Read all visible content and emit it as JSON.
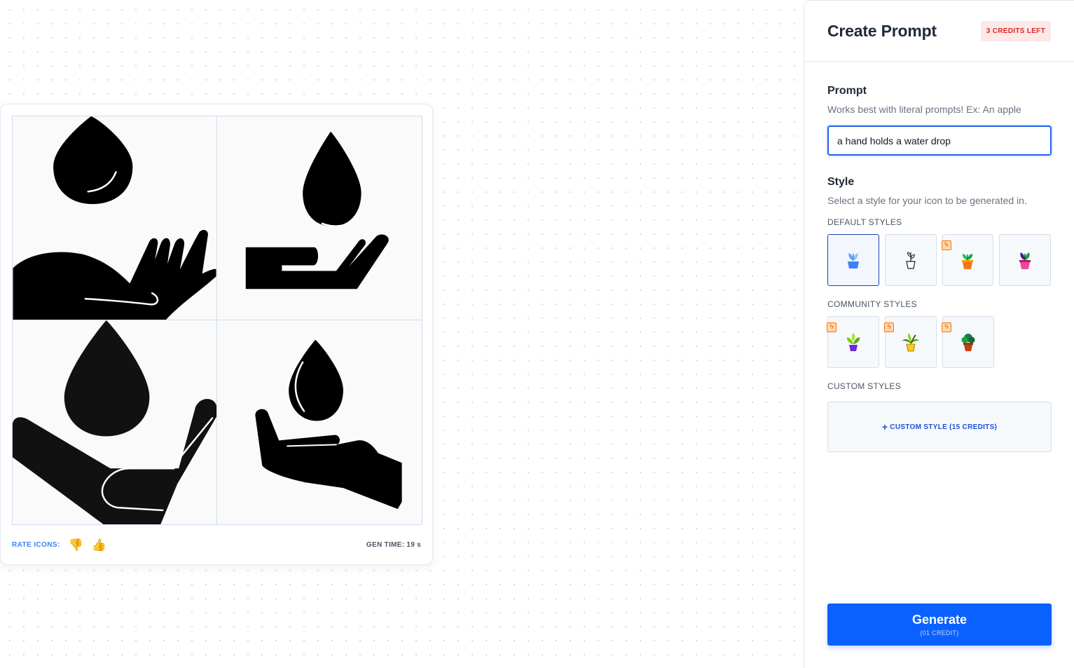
{
  "results": {
    "rate_label": "RATE ICONS:",
    "thumbs_down": "👎",
    "thumbs_up": "👍",
    "gen_time": "GEN TIME: 19 s"
  },
  "panel": {
    "title": "Create Prompt",
    "credits_badge": "3 CREDITS LEFT",
    "prompt": {
      "label": "Prompt",
      "help": "Works best with literal prompts! Ex: An apple",
      "value": "a hand holds a water drop"
    },
    "style": {
      "label": "Style",
      "help": "Select a style for your icon to be generated in.",
      "default_label": "DEFAULT STYLES",
      "default_styles": [
        {
          "icon": "flat-blue-plant-icon",
          "selected": true,
          "premium": false
        },
        {
          "icon": "outline-plant-icon",
          "selected": false,
          "premium": false
        },
        {
          "icon": "orange-pot-plant-icon",
          "selected": false,
          "premium": true
        },
        {
          "icon": "pink-pot-plant-icon",
          "selected": false,
          "premium": false
        }
      ],
      "community_label": "COMMUNITY STYLES",
      "community_styles": [
        {
          "icon": "purple-pot-plant-icon",
          "premium": true
        },
        {
          "icon": "yellow-pot-palm-icon",
          "premium": true
        },
        {
          "icon": "clay-pot-plant-icon",
          "premium": true
        }
      ],
      "custom_label": "CUSTOM STYLES",
      "custom_button_plus": "+",
      "custom_button": "CUSTOM STYLE (15 CREDITS)"
    },
    "generate": {
      "label": "Generate",
      "sub": "(01 CREDIT)"
    }
  },
  "colors": {
    "accent": "#0b61ff",
    "badge_bg": "#fde8e8",
    "badge_text": "#dc2626",
    "premium": "#f97316"
  }
}
